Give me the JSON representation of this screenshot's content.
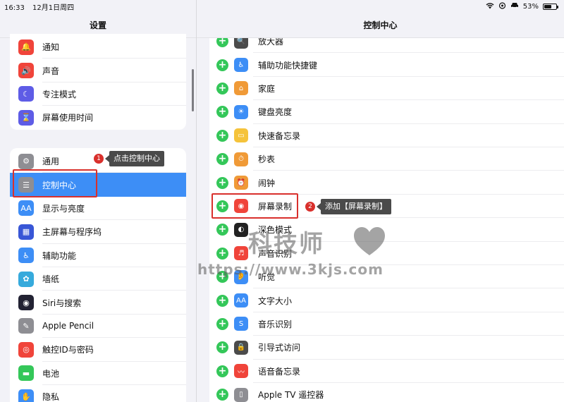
{
  "status_bar": {
    "time": "16:33",
    "date": "12月1日周四",
    "battery_percent": "53%",
    "battery_level": 0.53
  },
  "settings_pane": {
    "title": "设置",
    "group1": [
      {
        "label": "通知",
        "icon": "bell-icon",
        "color": "#f0443a",
        "glyph": "🔔"
      },
      {
        "label": "声音",
        "icon": "speaker-icon",
        "color": "#f0443a",
        "glyph": "🔊"
      },
      {
        "label": "专注模式",
        "icon": "moon-icon",
        "color": "#5e5ce6",
        "glyph": "☾"
      },
      {
        "label": "屏幕使用时间",
        "icon": "hourglass-icon",
        "color": "#5e5ce6",
        "glyph": "⌛"
      }
    ],
    "group2": [
      {
        "label": "通用",
        "icon": "gear-icon",
        "color": "#8e8e93",
        "glyph": "⚙"
      },
      {
        "label": "控制中心",
        "icon": "toggles-icon",
        "color": "#8e8e93",
        "glyph": "☰",
        "selected": true
      },
      {
        "label": "显示与亮度",
        "icon": "aa-icon",
        "color": "#3d8ef6",
        "glyph": "AA"
      },
      {
        "label": "主屏幕与程序坞",
        "icon": "grid-icon",
        "color": "#3856d6",
        "glyph": "▦"
      },
      {
        "label": "辅助功能",
        "icon": "accessibility-icon",
        "color": "#3d8ef6",
        "glyph": "♿"
      },
      {
        "label": "墙纸",
        "icon": "flower-icon",
        "color": "#36aadc",
        "glyph": "✿"
      },
      {
        "label": "Siri与搜索",
        "icon": "siri-icon",
        "color": "#222233",
        "glyph": "◉"
      },
      {
        "label": "Apple Pencil",
        "icon": "pencil-icon",
        "color": "#8e8e93",
        "glyph": "✎"
      },
      {
        "label": "触控ID与密码",
        "icon": "fingerprint-icon",
        "color": "#f0443a",
        "glyph": "◎"
      },
      {
        "label": "电池",
        "icon": "battery-icon",
        "color": "#34c759",
        "glyph": "▬"
      },
      {
        "label": "隐私",
        "icon": "hand-icon",
        "color": "#3d8ef6",
        "glyph": "✋"
      }
    ]
  },
  "control_center": {
    "title": "控制中心",
    "items": [
      {
        "label": "放大器",
        "icon": "magnifier-icon",
        "color": "#4b4b4b",
        "glyph": "🔍"
      },
      {
        "label": "辅助功能快捷键",
        "icon": "accessibility-icon",
        "color": "#3d8ef6",
        "glyph": "♿"
      },
      {
        "label": "家庭",
        "icon": "home-icon",
        "color": "#f09a37",
        "glyph": "⌂"
      },
      {
        "label": "键盘亮度",
        "icon": "keyboard-brightness-icon",
        "color": "#3d8ef6",
        "glyph": "☀"
      },
      {
        "label": "快速备忘录",
        "icon": "quick-note-icon",
        "color": "#f5c33b",
        "glyph": "▭"
      },
      {
        "label": "秒表",
        "icon": "stopwatch-icon",
        "color": "#f09a37",
        "glyph": "⏱"
      },
      {
        "label": "闹钟",
        "icon": "alarm-icon",
        "color": "#f09a37",
        "glyph": "⏰"
      },
      {
        "label": "屏幕录制",
        "icon": "screen-record-icon",
        "color": "#f0443a",
        "glyph": "◉"
      },
      {
        "label": "深色模式",
        "icon": "dark-mode-icon",
        "color": "#222222",
        "glyph": "◐"
      },
      {
        "label": "声音识别",
        "icon": "sound-recognition-icon",
        "color": "#f0443a",
        "glyph": "♬"
      },
      {
        "label": "听觉",
        "icon": "ear-icon",
        "color": "#3d8ef6",
        "glyph": "👂"
      },
      {
        "label": "文字大小",
        "icon": "text-size-icon",
        "color": "#3d8ef6",
        "glyph": "AA"
      },
      {
        "label": "音乐识别",
        "icon": "shazam-icon",
        "color": "#3d8ef6",
        "glyph": "S"
      },
      {
        "label": "引导式访问",
        "icon": "lock-icon",
        "color": "#4b4b4b",
        "glyph": "🔒"
      },
      {
        "label": "语音备忘录",
        "icon": "waveform-icon",
        "color": "#f0443a",
        "glyph": "〰"
      },
      {
        "label": "Apple TV 遥控器",
        "icon": "remote-icon",
        "color": "#8e8e93",
        "glyph": "▯"
      }
    ]
  },
  "annotations": {
    "step1_number": "1",
    "step1_text": "点击控制中心",
    "step2_number": "2",
    "step2_text": "添加【屏幕录制】"
  },
  "watermark": {
    "brand": "科技师",
    "url": "https://www.3kjs.com"
  }
}
